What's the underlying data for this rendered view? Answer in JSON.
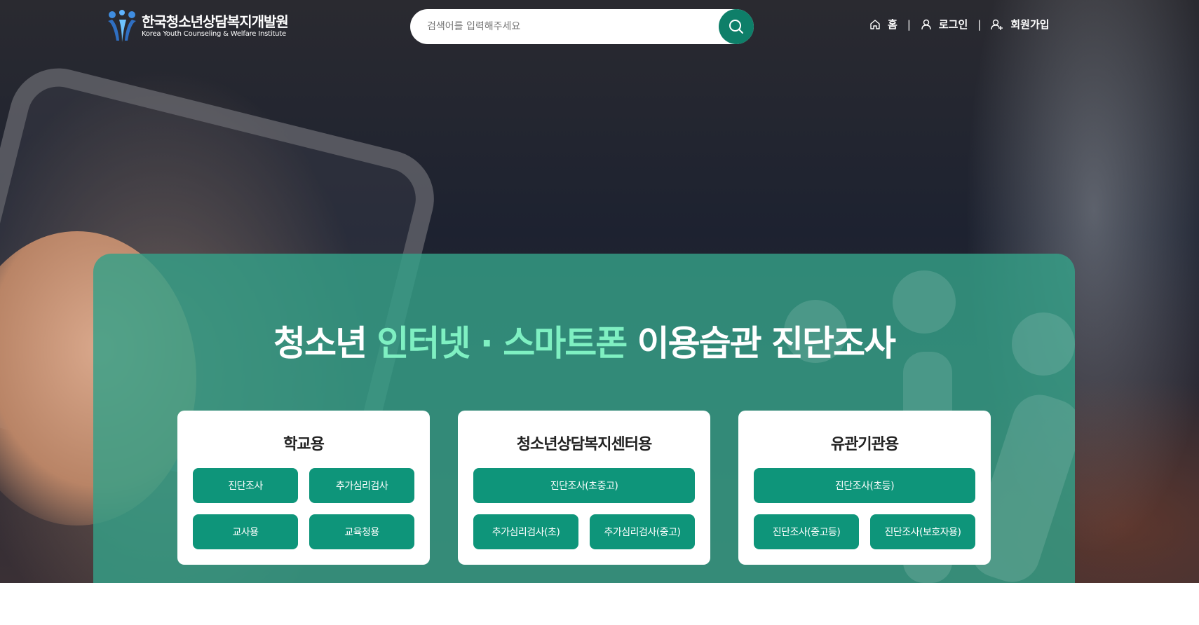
{
  "header": {
    "logo_kr": "한국청소년상담복지개발원",
    "logo_en": "Korea Youth Counseling & Welfare Institute",
    "search_placeholder": "검색어를 입력해주세요",
    "nav": {
      "home": "홈",
      "login": "로그인",
      "signup": "회원가입",
      "separator": "|"
    }
  },
  "hero": {
    "title_part1": "청소년 ",
    "title_highlight": "인터넷 · 스마트폰",
    "title_part2": " 이용습관 진단조사",
    "highlight_color": "#7ff0c2"
  },
  "cards": [
    {
      "title": "학교용",
      "buttons": [
        "진단조사",
        "추가심리검사",
        "교사용",
        "교육청용"
      ]
    },
    {
      "title": "청소년상담복지센터용",
      "buttons": [
        "진단조사(초중고)",
        "추가심리검사(초)",
        "추가심리검사(중고)"
      ]
    },
    {
      "title": "유관기관용",
      "buttons": [
        "진단조사(초등)",
        "진단조사(중고등)",
        "진단조사(보호자용)"
      ]
    }
  ],
  "colors": {
    "primary": "#0e957a",
    "search_button": "#0e7f69",
    "panel": "#34a088"
  },
  "icons": {
    "search": "search-icon",
    "home": "home-icon",
    "login": "user-icon",
    "signup": "user-plus-icon"
  }
}
